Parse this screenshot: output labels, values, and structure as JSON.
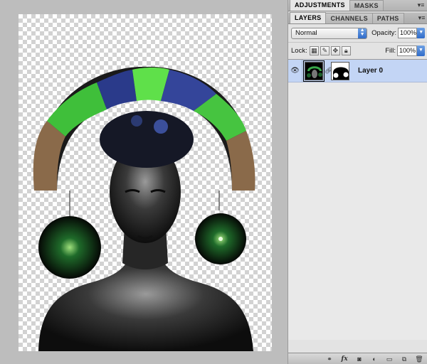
{
  "top_panel": {
    "tabs": [
      {
        "label": "ADJUSTMENTS",
        "active": true
      },
      {
        "label": "MASKS",
        "active": false
      }
    ]
  },
  "layers_panel": {
    "tabs": [
      {
        "label": "LAYERS",
        "active": true
      },
      {
        "label": "CHANNELS",
        "active": false
      },
      {
        "label": "PATHS",
        "active": false
      }
    ],
    "blend_mode": "Normal",
    "opacity_label": "Opacity:",
    "opacity_value": "100%",
    "lock_label": "Lock:",
    "fill_label": "Fill:",
    "fill_value": "100%",
    "layers": [
      {
        "name": "Layer 0",
        "visible": true,
        "selected": true,
        "has_mask": true
      }
    ],
    "bottom_icons": [
      "link-layers-icon",
      "fx-icon",
      "add-mask-icon",
      "adjustment-layer-icon",
      "new-group-icon",
      "new-layer-icon",
      "trash-icon"
    ],
    "fx_label": "fx"
  },
  "colors": {
    "selection_blue": "#c3d5f5",
    "dropdown_blue": "#2f6bc9",
    "checker_gray": "#d2d2d2"
  },
  "icons": {
    "panel_menu": "panel-menu-icon",
    "eye": "eye-icon",
    "chain": "chain-link-icon"
  }
}
